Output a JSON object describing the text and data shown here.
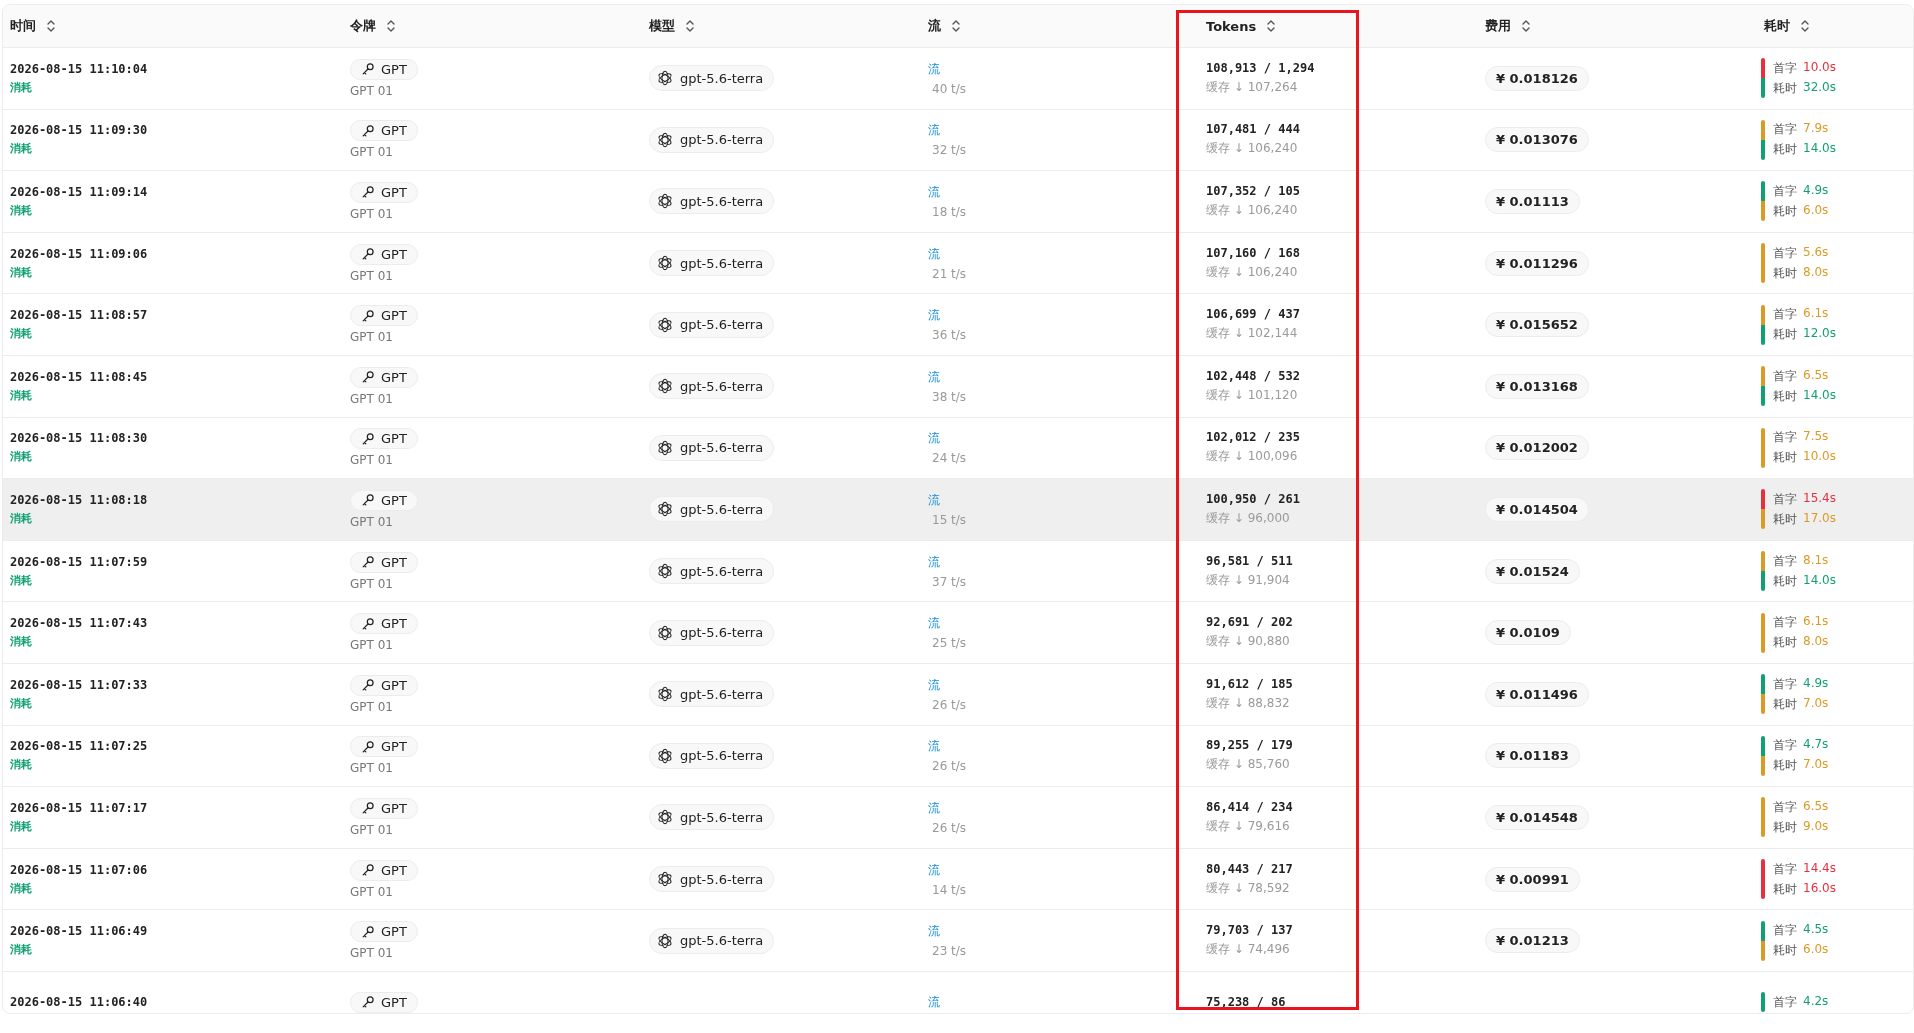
{
  "table": {
    "columns": [
      {
        "label": "时间"
      },
      {
        "label": "令牌"
      },
      {
        "label": "模型"
      },
      {
        "label": "流"
      },
      {
        "label": "Tokens"
      },
      {
        "label": "费用"
      },
      {
        "label": "耗时"
      }
    ],
    "rows": [
      {
        "time": "2026-08-15 11:10:04",
        "type": "消耗",
        "token_name": "GPT",
        "token_group": "GPT 01",
        "model": "gpt-5.6-terra",
        "stream": "流",
        "speed": "40 t/s",
        "tokens": "108,913 / 1,294",
        "cache": "缓存 ↓ 107,264",
        "cost": "¥ 0.018126",
        "latency": [
          {
            "label": "首字",
            "value": "10.0s",
            "color": "#e5313d"
          },
          {
            "label": "耗时",
            "value": "32.0s",
            "color": "#12a073"
          }
        ],
        "hovered": false
      },
      {
        "time": "2026-08-15 11:09:30",
        "type": "消耗",
        "token_name": "GPT",
        "token_group": "GPT 01",
        "model": "gpt-5.6-terra",
        "stream": "流",
        "speed": "32 t/s",
        "tokens": "107,481 / 444",
        "cache": "缓存 ↓ 106,240",
        "cost": "¥ 0.013076",
        "latency": [
          {
            "label": "首字",
            "value": "7.9s",
            "color": "#d99a26"
          },
          {
            "label": "耗时",
            "value": "14.0s",
            "color": "#12a073"
          }
        ],
        "hovered": false
      },
      {
        "time": "2026-08-15 11:09:14",
        "type": "消耗",
        "token_name": "GPT",
        "token_group": "GPT 01",
        "model": "gpt-5.6-terra",
        "stream": "流",
        "speed": "18 t/s",
        "tokens": "107,352 / 105",
        "cache": "缓存 ↓ 106,240",
        "cost": "¥ 0.01113",
        "latency": [
          {
            "label": "首字",
            "value": "4.9s",
            "color": "#12a073"
          },
          {
            "label": "耗时",
            "value": "6.0s",
            "color": "#d99a26"
          }
        ],
        "hovered": false
      },
      {
        "time": "2026-08-15 11:09:06",
        "type": "消耗",
        "token_name": "GPT",
        "token_group": "GPT 01",
        "model": "gpt-5.6-terra",
        "stream": "流",
        "speed": "21 t/s",
        "tokens": "107,160 / 168",
        "cache": "缓存 ↓ 106,240",
        "cost": "¥ 0.011296",
        "latency": [
          {
            "label": "首字",
            "value": "5.6s",
            "color": "#d99a26"
          },
          {
            "label": "耗时",
            "value": "8.0s",
            "color": "#d99a26"
          }
        ],
        "hovered": false
      },
      {
        "time": "2026-08-15 11:08:57",
        "type": "消耗",
        "token_name": "GPT",
        "token_group": "GPT 01",
        "model": "gpt-5.6-terra",
        "stream": "流",
        "speed": "36 t/s",
        "tokens": "106,699 / 437",
        "cache": "缓存 ↓ 102,144",
        "cost": "¥ 0.015652",
        "latency": [
          {
            "label": "首字",
            "value": "6.1s",
            "color": "#d99a26"
          },
          {
            "label": "耗时",
            "value": "12.0s",
            "color": "#12a073"
          }
        ],
        "hovered": false
      },
      {
        "time": "2026-08-15 11:08:45",
        "type": "消耗",
        "token_name": "GPT",
        "token_group": "GPT 01",
        "model": "gpt-5.6-terra",
        "stream": "流",
        "speed": "38 t/s",
        "tokens": "102,448 / 532",
        "cache": "缓存 ↓ 101,120",
        "cost": "¥ 0.013168",
        "latency": [
          {
            "label": "首字",
            "value": "6.5s",
            "color": "#d99a26"
          },
          {
            "label": "耗时",
            "value": "14.0s",
            "color": "#12a073"
          }
        ],
        "hovered": false
      },
      {
        "time": "2026-08-15 11:08:30",
        "type": "消耗",
        "token_name": "GPT",
        "token_group": "GPT 01",
        "model": "gpt-5.6-terra",
        "stream": "流",
        "speed": "24 t/s",
        "tokens": "102,012 / 235",
        "cache": "缓存 ↓ 100,096",
        "cost": "¥ 0.012002",
        "latency": [
          {
            "label": "首字",
            "value": "7.5s",
            "color": "#d99a26"
          },
          {
            "label": "耗时",
            "value": "10.0s",
            "color": "#d99a26"
          }
        ],
        "hovered": false
      },
      {
        "time": "2026-08-15 11:08:18",
        "type": "消耗",
        "token_name": "GPT",
        "token_group": "GPT 01",
        "model": "gpt-5.6-terra",
        "stream": "流",
        "speed": "15 t/s",
        "tokens": "100,950 / 261",
        "cache": "缓存 ↓ 96,000",
        "cost": "¥ 0.014504",
        "latency": [
          {
            "label": "首字",
            "value": "15.4s",
            "color": "#e5313d"
          },
          {
            "label": "耗时",
            "value": "17.0s",
            "color": "#d99a26"
          }
        ],
        "hovered": true
      },
      {
        "time": "2026-08-15 11:07:59",
        "type": "消耗",
        "token_name": "GPT",
        "token_group": "GPT 01",
        "model": "gpt-5.6-terra",
        "stream": "流",
        "speed": "37 t/s",
        "tokens": "96,581 / 511",
        "cache": "缓存 ↓ 91,904",
        "cost": "¥ 0.01524",
        "latency": [
          {
            "label": "首字",
            "value": "8.1s",
            "color": "#d99a26"
          },
          {
            "label": "耗时",
            "value": "14.0s",
            "color": "#12a073"
          }
        ],
        "hovered": false
      },
      {
        "time": "2026-08-15 11:07:43",
        "type": "消耗",
        "token_name": "GPT",
        "token_group": "GPT 01",
        "model": "gpt-5.6-terra",
        "stream": "流",
        "speed": "25 t/s",
        "tokens": "92,691 / 202",
        "cache": "缓存 ↓ 90,880",
        "cost": "¥ 0.0109",
        "latency": [
          {
            "label": "首字",
            "value": "6.1s",
            "color": "#d99a26"
          },
          {
            "label": "耗时",
            "value": "8.0s",
            "color": "#d99a26"
          }
        ],
        "hovered": false
      },
      {
        "time": "2026-08-15 11:07:33",
        "type": "消耗",
        "token_name": "GPT",
        "token_group": "GPT 01",
        "model": "gpt-5.6-terra",
        "stream": "流",
        "speed": "26 t/s",
        "tokens": "91,612 / 185",
        "cache": "缓存 ↓ 88,832",
        "cost": "¥ 0.011496",
        "latency": [
          {
            "label": "首字",
            "value": "4.9s",
            "color": "#12a073"
          },
          {
            "label": "耗时",
            "value": "7.0s",
            "color": "#d99a26"
          }
        ],
        "hovered": false
      },
      {
        "time": "2026-08-15 11:07:25",
        "type": "消耗",
        "token_name": "GPT",
        "token_group": "GPT 01",
        "model": "gpt-5.6-terra",
        "stream": "流",
        "speed": "26 t/s",
        "tokens": "89,255 / 179",
        "cache": "缓存 ↓ 85,760",
        "cost": "¥ 0.01183",
        "latency": [
          {
            "label": "首字",
            "value": "4.7s",
            "color": "#12a073"
          },
          {
            "label": "耗时",
            "value": "7.0s",
            "color": "#d99a26"
          }
        ],
        "hovered": false
      },
      {
        "time": "2026-08-15 11:07:17",
        "type": "消耗",
        "token_name": "GPT",
        "token_group": "GPT 01",
        "model": "gpt-5.6-terra",
        "stream": "流",
        "speed": "26 t/s",
        "tokens": "86,414 / 234",
        "cache": "缓存 ↓ 79,616",
        "cost": "¥ 0.014548",
        "latency": [
          {
            "label": "首字",
            "value": "6.5s",
            "color": "#d99a26"
          },
          {
            "label": "耗时",
            "value": "9.0s",
            "color": "#d99a26"
          }
        ],
        "hovered": false
      },
      {
        "time": "2026-08-15 11:07:06",
        "type": "消耗",
        "token_name": "GPT",
        "token_group": "GPT 01",
        "model": "gpt-5.6-terra",
        "stream": "流",
        "speed": "14 t/s",
        "tokens": "80,443 / 217",
        "cache": "缓存 ↓ 78,592",
        "cost": "¥ 0.00991",
        "latency": [
          {
            "label": "首字",
            "value": "14.4s",
            "color": "#e5313d"
          },
          {
            "label": "耗时",
            "value": "16.0s",
            "color": "#e5313d"
          }
        ],
        "hovered": false
      },
      {
        "time": "2026-08-15 11:06:49",
        "type": "消耗",
        "token_name": "GPT",
        "token_group": "GPT 01",
        "model": "gpt-5.6-terra",
        "stream": "流",
        "speed": "23 t/s",
        "tokens": "79,703 / 137",
        "cache": "缓存 ↓ 74,496",
        "cost": "¥ 0.01213",
        "latency": [
          {
            "label": "首字",
            "value": "4.5s",
            "color": "#12a073"
          },
          {
            "label": "耗时",
            "value": "6.0s",
            "color": "#d99a26"
          }
        ],
        "hovered": false
      },
      {
        "time": "2026-08-15 11:06:40",
        "token_name": "GPT",
        "stream": "流",
        "tokens": "75,238 / 86",
        "latency": [
          {
            "label": "首字",
            "value": "4.2s",
            "color": "#12a073"
          }
        ],
        "hovered": false
      }
    ]
  }
}
